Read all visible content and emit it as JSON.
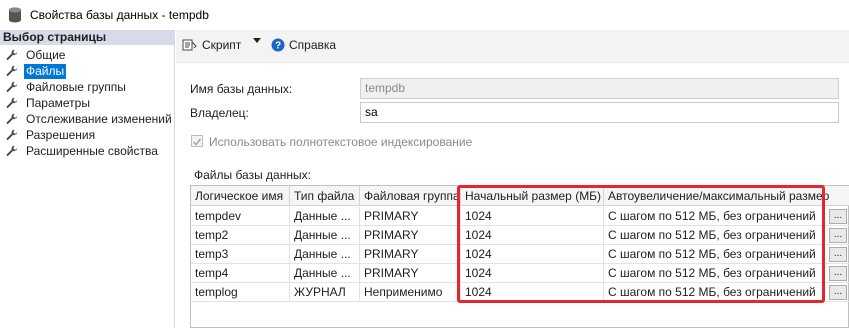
{
  "window": {
    "title": "Свойства базы данных - tempdb",
    "icon": "database-icon"
  },
  "sidebar": {
    "header": "Выбор страницы",
    "items": [
      {
        "label": "Общие",
        "icon": "wrench-icon",
        "selected": false
      },
      {
        "label": "Файлы",
        "icon": "wrench-icon",
        "selected": true
      },
      {
        "label": "Файловые группы",
        "icon": "wrench-icon",
        "selected": false
      },
      {
        "label": "Параметры",
        "icon": "wrench-icon",
        "selected": false
      },
      {
        "label": "Отслеживание изменений",
        "icon": "wrench-icon",
        "selected": false
      },
      {
        "label": "Разрешения",
        "icon": "wrench-icon",
        "selected": false
      },
      {
        "label": "Расширенные свойства",
        "icon": "wrench-icon",
        "selected": false
      }
    ]
  },
  "toolbar": {
    "script_label": "Скрипт",
    "help_label": "Справка"
  },
  "form": {
    "db_name_label": "Имя базы данных:",
    "db_name_value": "tempdb",
    "owner_label": "Владелец:",
    "owner_value": "sa",
    "fulltext_label": "Использовать полнотекстовое индексирование",
    "fulltext_checked": true,
    "files_label": "Файлы базы данных:"
  },
  "grid": {
    "columns": [
      "Логическое имя",
      "Тип файла",
      "Файловая группа",
      "Начальный размер (МБ)",
      "Автоувеличение/максимальный размер"
    ],
    "rows": [
      [
        "tempdev",
        "Данные ...",
        "PRIMARY",
        "1024",
        "С шагом по 512 МБ, без ограничений"
      ],
      [
        "temp2",
        "Данные ...",
        "PRIMARY",
        "1024",
        "С шагом по 512 МБ, без ограничений"
      ],
      [
        "temp3",
        "Данные ...",
        "PRIMARY",
        "1024",
        "С шагом по 512 МБ, без ограничений"
      ],
      [
        "temp4",
        "Данные ...",
        "PRIMARY",
        "1024",
        "С шагом по 512 МБ, без ограничений"
      ],
      [
        "templog",
        "ЖУРНАЛ",
        "Неприменимо",
        "1024",
        "С шагом по 512 МБ, без ограничений"
      ]
    ],
    "ellipsis_label": "..."
  },
  "colors": {
    "accent": "#0078d7",
    "highlight": "#e0282e",
    "sidebar_header": "#d6dbe9"
  }
}
